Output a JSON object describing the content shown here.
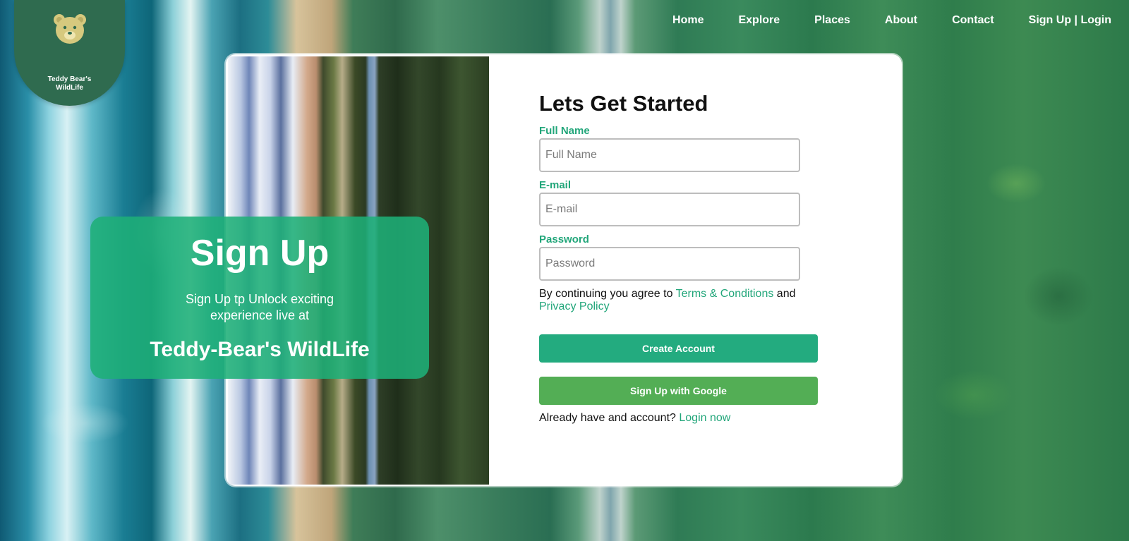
{
  "brand": {
    "name": "Teddy Bear's WildLife",
    "icon": "bear-icon"
  },
  "nav": {
    "items": [
      "Home",
      "Explore",
      "Places",
      "About",
      "Contact",
      "Sign Up | Login"
    ]
  },
  "hero": {
    "title": "Sign Up",
    "subtitle": "Sign Up tp Unlock exciting experience live at",
    "name": "Teddy-Bear's WildLife"
  },
  "form": {
    "heading": "Lets Get Started",
    "full_name": {
      "label": "Full Name",
      "placeholder": "Full Name",
      "value": ""
    },
    "email": {
      "label": "E-mail",
      "placeholder": "E-mail",
      "value": ""
    },
    "password": {
      "label": "Password",
      "placeholder": "Password",
      "value": ""
    },
    "agree_prefix": "By continuing you agree to",
    "terms_link": "Terms & Conditions",
    "agree_and": "and",
    "privacy_link": "Privacy Policy",
    "create_button": "Create Account",
    "google_button": "Sign Up with Google",
    "login_prefix": "Already have and account?",
    "login_link": "Login now"
  },
  "colors": {
    "accent": "#22a67a",
    "google_button": "#53ae55",
    "logo_bg": "#2f6b4f",
    "hero_bg": "#1eaf78"
  }
}
